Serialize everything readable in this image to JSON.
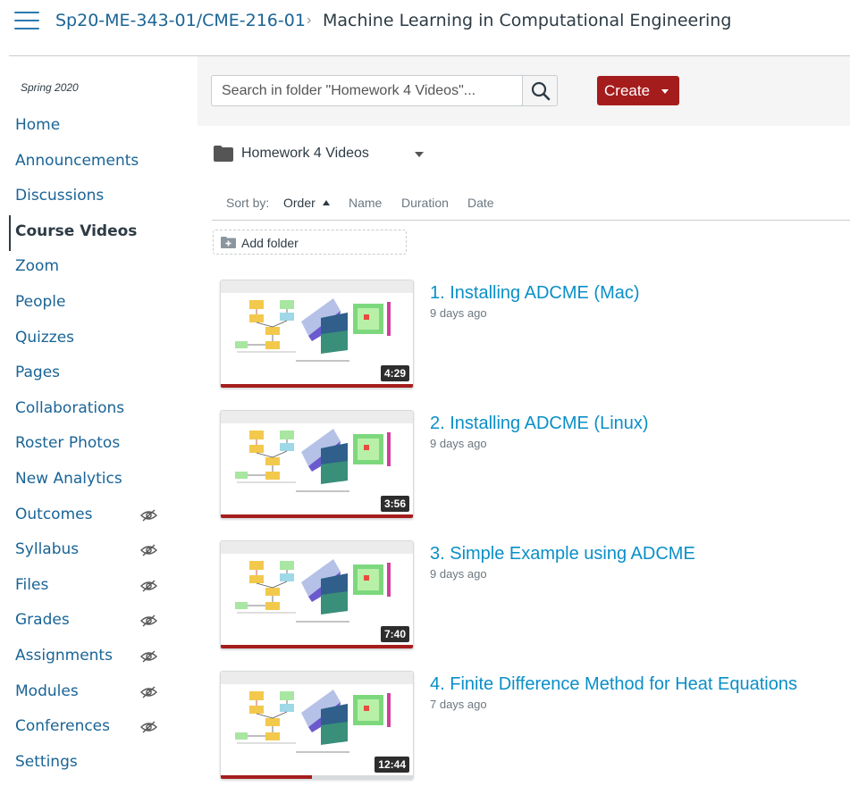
{
  "header": {
    "course": "Sp20-ME-343-01/CME-216-01",
    "separator": "›",
    "page": "Machine Learning in Computational Engineering"
  },
  "sidebar": {
    "term": "Spring 2020",
    "items": [
      {
        "label": "Home",
        "hidden": false
      },
      {
        "label": "Announcements",
        "hidden": false
      },
      {
        "label": "Discussions",
        "hidden": false
      },
      {
        "label": "Course Videos",
        "hidden": false,
        "active": true
      },
      {
        "label": "Zoom",
        "hidden": false
      },
      {
        "label": "People",
        "hidden": false
      },
      {
        "label": "Quizzes",
        "hidden": false
      },
      {
        "label": "Pages",
        "hidden": false
      },
      {
        "label": "Collaborations",
        "hidden": false
      },
      {
        "label": "Roster Photos",
        "hidden": false
      },
      {
        "label": "New Analytics",
        "hidden": false
      },
      {
        "label": "Outcomes",
        "hidden": true
      },
      {
        "label": "Syllabus",
        "hidden": true
      },
      {
        "label": "Files",
        "hidden": true
      },
      {
        "label": "Grades",
        "hidden": true
      },
      {
        "label": "Assignments",
        "hidden": true
      },
      {
        "label": "Modules",
        "hidden": true
      },
      {
        "label": "Conferences",
        "hidden": true
      },
      {
        "label": "Settings",
        "hidden": false
      }
    ]
  },
  "toolbar": {
    "search_placeholder": "Search in folder \"Homework 4 Videos\"...",
    "search_icon": "search-icon",
    "create_label": "Create"
  },
  "folder": {
    "name": "Homework 4 Videos",
    "icon": "folder-icon"
  },
  "sort": {
    "label": "Sort by:",
    "options": [
      "Order",
      "Name",
      "Duration",
      "Date"
    ],
    "active": "Order"
  },
  "add_folder_label": "Add folder",
  "videos": [
    {
      "title": "1. Installing ADCME (Mac)",
      "age": "9 days ago",
      "duration": "4:29",
      "progress": 1.0
    },
    {
      "title": "2. Installing ADCME (Linux)",
      "age": "9 days ago",
      "duration": "3:56",
      "progress": 1.0
    },
    {
      "title": "3. Simple Example using ADCME",
      "age": "9 days ago",
      "duration": "7:40",
      "progress": 1.0
    },
    {
      "title": "4. Finite Difference Method for Heat Equations",
      "age": "7 days ago",
      "duration": "12:44",
      "progress": 0.47
    }
  ],
  "colors": {
    "link": "#1a6496",
    "video_title": "#0a8fc7",
    "create_button": "#a51c1c",
    "progress": "#a51c1c"
  }
}
